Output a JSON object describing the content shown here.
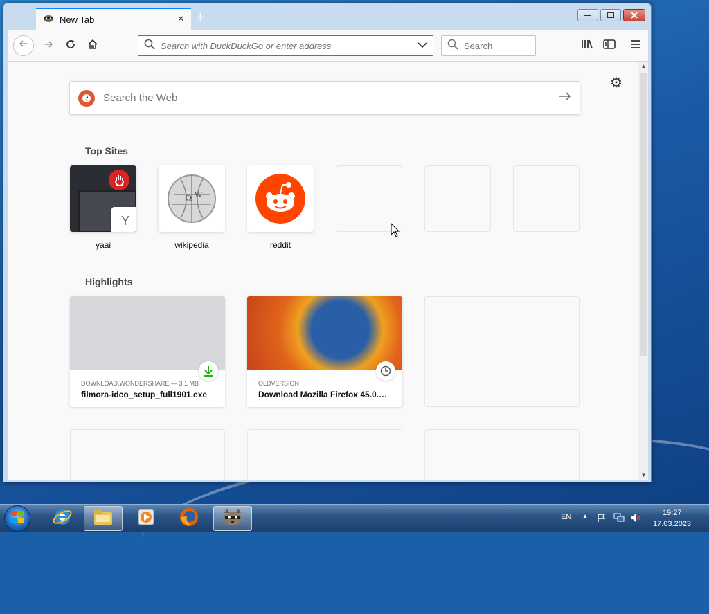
{
  "browser": {
    "tab": {
      "title": "New Tab",
      "close": "×"
    },
    "new_tab_symbol": "+",
    "url_placeholder": "Search with DuckDuckGo or enter address",
    "search_placeholder": "Search"
  },
  "newtab": {
    "web_search_placeholder": "Search the Web",
    "top_sites_title": "Top Sites",
    "top_sites": [
      {
        "label": "yaai",
        "letter": "Y"
      },
      {
        "label": "wikipedia"
      },
      {
        "label": "reddit"
      },
      {
        "label": ""
      },
      {
        "label": ""
      },
      {
        "label": ""
      }
    ],
    "highlights_title": "Highlights",
    "highlights": [
      {
        "source": "DOWNLOAD.WONDERSHARE — 3.1 MB",
        "title": "filmora-idco_setup_full1901.exe",
        "badge": "download-icon"
      },
      {
        "source": "OLDVERSION",
        "title": "Download Mozilla Firefox 45.0.1 ...",
        "badge": "clock-icon"
      }
    ]
  },
  "taskbar": {
    "language": "EN",
    "time": "19:27",
    "date": "17.03.2023"
  },
  "colors": {
    "accent": "#0a84ff",
    "reddit": "#ff4500",
    "ddg": "#de5833"
  }
}
